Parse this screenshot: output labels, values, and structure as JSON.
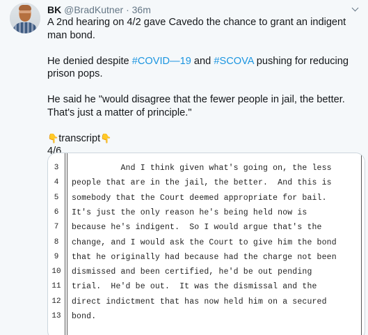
{
  "author": {
    "name": "BK",
    "handle": "@BradKutner",
    "separator": "·",
    "time": "36m"
  },
  "tweet": {
    "para1": "A 2nd hearing on 4/2 gave Cavedo the chance to grant an indigent man bond.",
    "para2_before": "He denied despite ",
    "hashtag1": "#COVID—19",
    "para2_mid": " and ",
    "hashtag2": "#SCOVA",
    "para2_after": " pushing for reducing prison pops.",
    "para3": "He said he \"would disagree that the fewer people in jail, the better. That's just a matter of principle.\"",
    "emoji_left": "👇",
    "transcript_label": "transcript",
    "emoji_right": "👇",
    "count": "4/6"
  },
  "transcript": {
    "lines": [
      {
        "num": "3",
        "text": "          And I think given what's going on, the less"
      },
      {
        "num": "4",
        "text": "people that are in the jail, the better.  And this is"
      },
      {
        "num": "5",
        "text": "somebody that the Court deemed appropriate for bail."
      },
      {
        "num": "6",
        "text": "It's just the only reason he's being held now is"
      },
      {
        "num": "7",
        "text": "because he's indigent.  So I would argue that's the"
      },
      {
        "num": "8",
        "text": "change, and I would ask the Court to give him the bond"
      },
      {
        "num": "9",
        "text": "that he originally had because had the charge not been"
      },
      {
        "num": "10",
        "text": "dismissed and been certified, he'd be out pending"
      },
      {
        "num": "11",
        "text": "trial.  He'd be out.  It was the dismissal and the"
      },
      {
        "num": "12",
        "text": "direct indictment that has now held him on a secured"
      },
      {
        "num": "13",
        "text": "bond."
      }
    ]
  }
}
